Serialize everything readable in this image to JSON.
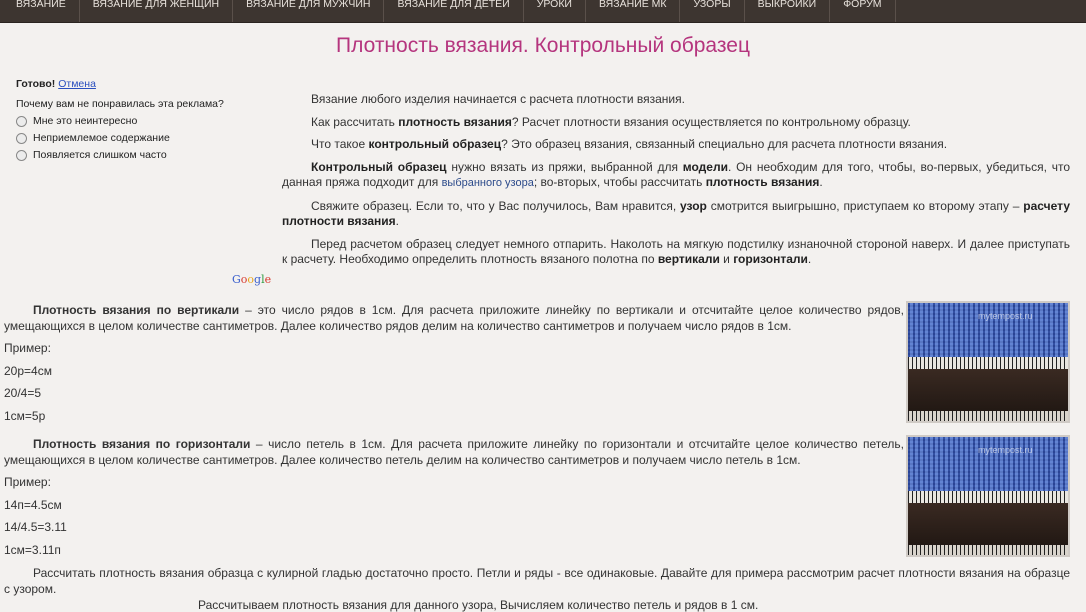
{
  "nav": {
    "items": [
      "ВЯЗАНИЕ",
      "ВЯЗАНИЕ ДЛЯ ЖЕНЩИН",
      "ВЯЗАНИЕ ДЛЯ МУЖЧИН",
      "ВЯЗАНИЕ ДЛЯ ДЕТЕЙ",
      "УРОКИ",
      "ВЯЗАНИЕ МК",
      "УЗОРЫ",
      "ВЫКРОЙКИ",
      "ФОРУМ"
    ]
  },
  "page_title": "Плотность вязания. Контрольный образец",
  "ad_feedback": {
    "done": "Готово!",
    "cancel": "Отмена",
    "question": "Почему вам не понравилась эта реклама?",
    "options": [
      "Мне это неинтересно",
      "Неприемлемое содержание",
      "Появляется слишком часто"
    ],
    "google": [
      "G",
      "o",
      "o",
      "g",
      "l",
      "e"
    ]
  },
  "intro": {
    "p1": "Вязание любого изделия начинается с расчета плотности вязания.",
    "p2_a": "Как рассчитать ",
    "p2_b": "плотность вязания",
    "p2_c": "? Расчет плотности вязания осуществляется по контрольному образцу.",
    "p3_a": "Что такое ",
    "p3_b": "контрольный образец",
    "p3_c": "? Это образец вязания, связанный специально для расчета плотности вязания.",
    "p4_a": "Контрольный образец",
    "p4_b": " нужно вязать из пряжи, выбранной для ",
    "p4_c": "модели",
    "p4_d": ". Он необходим для того, чтобы, во-первых, убедиться, что данная пряжа подходит для ",
    "p4_link": "выбранного узора",
    "p4_e": "; во-вторых, чтобы рассчитать ",
    "p4_f": "плотность вязания",
    "p4_g": ".",
    "p5_a": "Свяжите образец. Если то, что у Вас получилось, Вам нравится, ",
    "p5_b": "узор",
    "p5_c": " смотрится выигрышно, приступаем ко второму этапу – ",
    "p5_d": "расчету плотности вязания",
    "p5_e": ".",
    "p6_a": "Перед расчетом образец следует немного отпарить. Наколоть на мягкую подстилку изнаночной стороной наверх. И далее приступать к расчету. Необходимо определить плотность вязаного полотна по ",
    "p6_b": "вертикали",
    "p6_c": " и ",
    "p6_d": "горизонтали",
    "p6_e": "."
  },
  "vertical": {
    "title": "Плотность вязания по вертикали",
    "text": " – это число рядов в 1см. Для расчета приложите линейку по вертикали и отсчитайте целое количество рядов, умещающихся в целом количестве сантиметров. Далее количество рядов делим на количество сантиметров и получаем число рядов в 1см.",
    "example_label": "Пример:",
    "lines": [
      "20р=4см",
      "20/4=5",
      "1см=5р"
    ],
    "watermark": "mytempost.ru"
  },
  "horizontal": {
    "title": "Плотность вязания по горизонтали",
    "text": " – число петель в 1см. Для расчета приложите линейку по горизонтали и отсчитайте целое количество петель, умещающихся в целом количестве сантиметров. Далее количество петель делим на количество сантиметров и получаем число петель в 1см.",
    "example_label": "Пример:",
    "lines": [
      "14п=4.5см",
      "14/4.5=3.11",
      "1см=3.11п"
    ],
    "watermark": "mytempost.ru"
  },
  "outro": "Рассчитать плотность вязания образца с кулирной гладью достаточно просто. Петли и ряды - все одинаковые. Давайте для примера рассмотрим расчет плотности вязания на образце с узором.",
  "cut_line": "Рассчитываем плотность вязания для данного узора, Вычисляем количество петель и рядов в 1 см."
}
